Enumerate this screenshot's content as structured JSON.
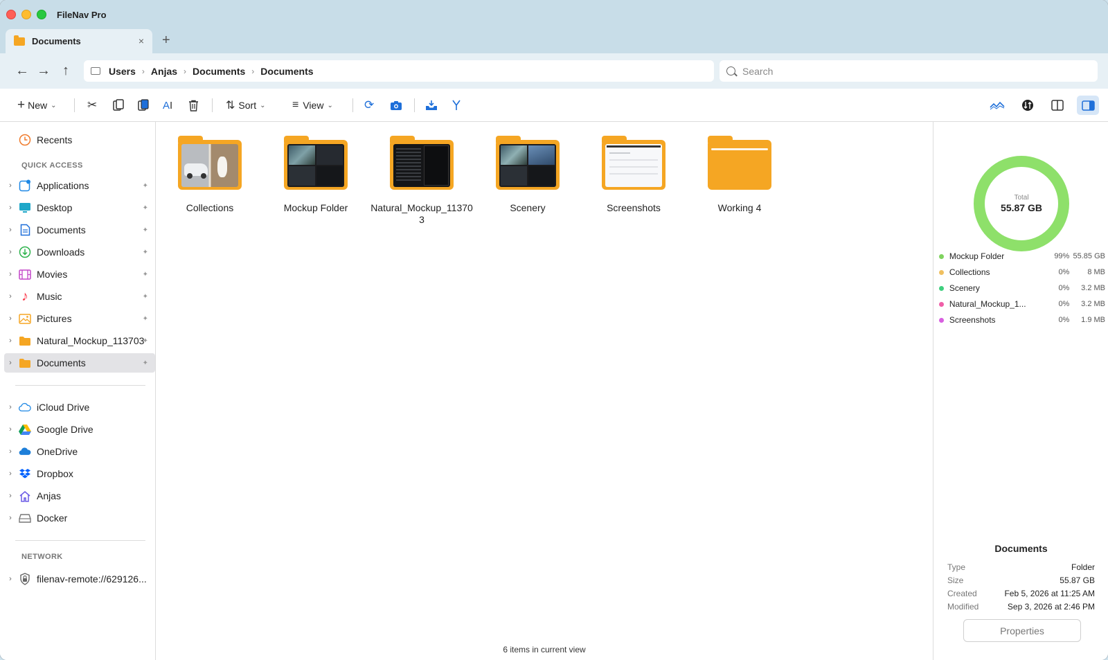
{
  "app": {
    "title": "FileNav Pro"
  },
  "tabs": [
    {
      "label": "Documents",
      "close": "×"
    }
  ],
  "tab_add": "+",
  "nav": {
    "back": "←",
    "forward": "→",
    "up": "↑"
  },
  "breadcrumb": [
    "Users",
    "Anjas",
    "Documents",
    "Documents"
  ],
  "breadcrumb_sep": "›",
  "search": {
    "placeholder": "Search",
    "value": ""
  },
  "toolbar": {
    "new_label": "New",
    "sort_label": "Sort",
    "view_label": "View"
  },
  "sidebar": {
    "recents": "Recents",
    "quick_access_header": "QUICK ACCESS",
    "quick_access": [
      {
        "label": "Applications",
        "icon": "applications-icon",
        "color": "#1e88e5"
      },
      {
        "label": "Desktop",
        "icon": "desktop-icon",
        "color": "#1ea7c9"
      },
      {
        "label": "Documents",
        "icon": "document-icon",
        "color": "#1e6fd9"
      },
      {
        "label": "Downloads",
        "icon": "download-icon",
        "color": "#2db24c"
      },
      {
        "label": "Movies",
        "icon": "movies-icon",
        "color": "#c347c9"
      },
      {
        "label": "Music",
        "icon": "music-icon",
        "color": "#fa3a4c"
      },
      {
        "label": "Pictures",
        "icon": "pictures-icon",
        "color": "#f5a623"
      },
      {
        "label": "Natural_Mockup_113703",
        "icon": "folder-icon",
        "color": "#f5a623"
      },
      {
        "label": "Documents",
        "icon": "folder-icon",
        "color": "#f5a623",
        "selected": true
      }
    ],
    "cloud": [
      {
        "label": "iCloud Drive",
        "icon": "icloud-icon"
      },
      {
        "label": "Google Drive",
        "icon": "google-drive-icon"
      },
      {
        "label": "OneDrive",
        "icon": "onedrive-icon"
      },
      {
        "label": "Dropbox",
        "icon": "dropbox-icon"
      },
      {
        "label": "Anjas",
        "icon": "home-icon"
      },
      {
        "label": "Docker",
        "icon": "drive-icon"
      }
    ],
    "network_header": "NETWORK",
    "network": [
      {
        "label": "filenav-remote://629126...",
        "icon": "lock-icon"
      }
    ]
  },
  "folders": [
    {
      "name": "Collections",
      "thumb": "photos"
    },
    {
      "name": "Mockup Folder",
      "thumb": "mockup"
    },
    {
      "name": "Natural_Mockup_113703",
      "thumb": "dark"
    },
    {
      "name": "Scenery",
      "thumb": "mockup"
    },
    {
      "name": "Screenshots",
      "thumb": "light"
    },
    {
      "name": "Working 4",
      "thumb": "empty"
    }
  ],
  "status": "6 items in current view",
  "storage": {
    "total_label": "Total",
    "total_value": "55.87 GB",
    "ring_color": "#8ee06a",
    "items": [
      {
        "name": "Mockup Folder",
        "pct": "99%",
        "size": "55.85 GB",
        "color": "#7fd35e"
      },
      {
        "name": "Collections",
        "pct": "0%",
        "size": "8 MB",
        "color": "#f0c060"
      },
      {
        "name": "Scenery",
        "pct": "0%",
        "size": "3.2 MB",
        "color": "#3fcf7e"
      },
      {
        "name": "Natural_Mockup_1...",
        "pct": "0%",
        "size": "3.2 MB",
        "color": "#f05fa8"
      },
      {
        "name": "Screenshots",
        "pct": "0%",
        "size": "1.9 MB",
        "color": "#d85fe0"
      }
    ]
  },
  "info": {
    "title": "Documents",
    "rows": [
      {
        "key": "Type",
        "value": "Folder"
      },
      {
        "key": "Size",
        "value": "55.87 GB"
      },
      {
        "key": "Created",
        "value": "Feb 5, 2026 at 11:25 AM"
      },
      {
        "key": "Modified",
        "value": "Sep 3, 2026 at 2:46 PM"
      }
    ],
    "button": "Properties"
  }
}
